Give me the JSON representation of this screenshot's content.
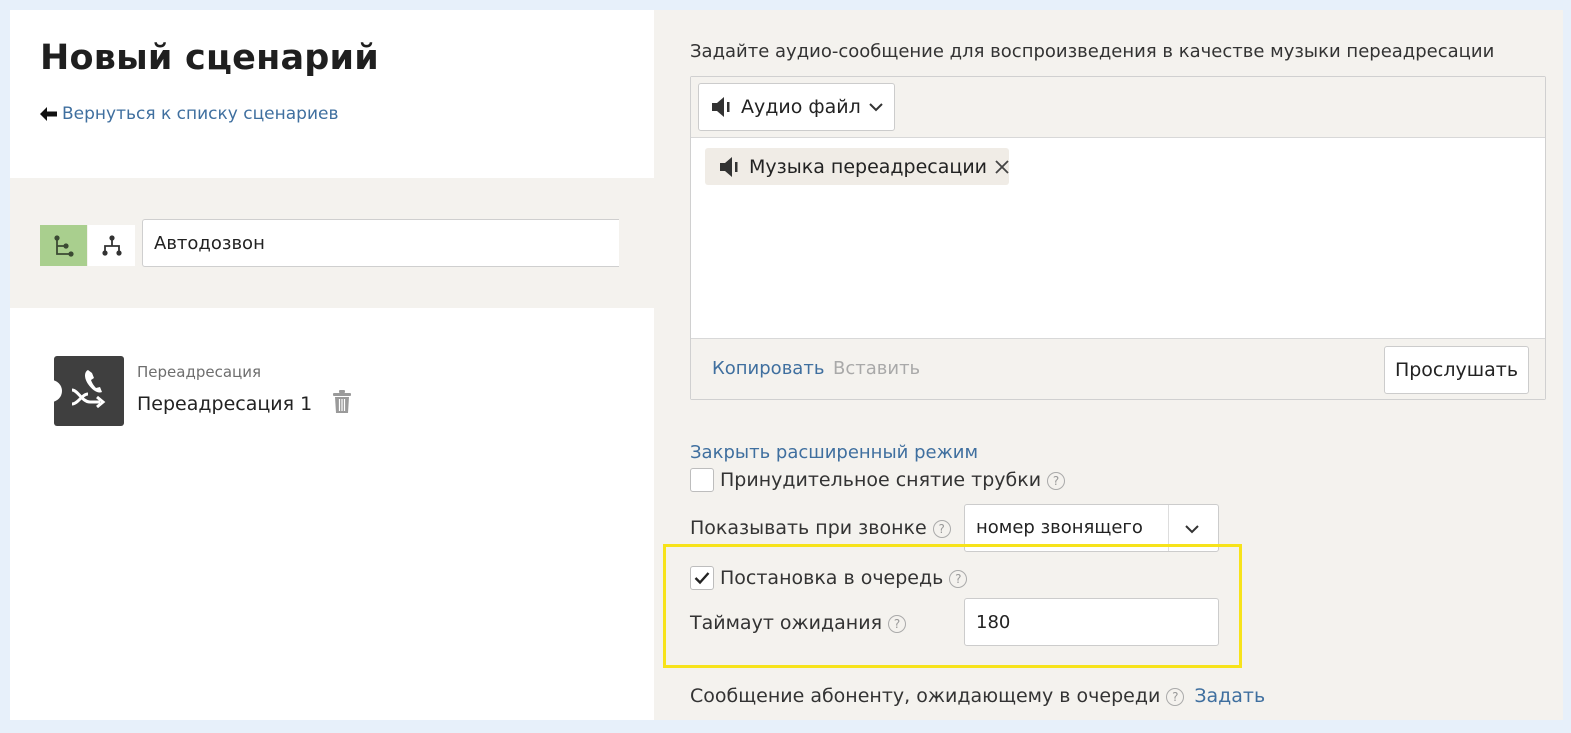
{
  "page": {
    "title": "Новый сценарий",
    "back_link": "Вернуться к списку сценариев"
  },
  "toolbar": {
    "scenario_name": "Автодозвон"
  },
  "node": {
    "type": "Переадресация",
    "name": "Переадресация 1"
  },
  "audio": {
    "heading": "Задайте аудио-сообщение для воспроизведения в качестве музыки переадресации",
    "source_dropdown": "Аудио файл",
    "selected_file": "Музыка переадресации",
    "copy": "Копировать",
    "paste": "Вставить",
    "listen": "Прослушать"
  },
  "advanced": {
    "close_link": "Закрыть расширенный режим",
    "force_pickup_label": "Принудительное снятие трубки",
    "force_pickup_checked": false,
    "show_on_call_label": "Показывать при звонке",
    "show_on_call_value": "номер звонящего",
    "queue_label": "Постановка в очередь",
    "queue_checked": true,
    "timeout_label": "Таймаут ожидания",
    "timeout_value": "180",
    "queue_message_label": "Сообщение абоненту, ожидающему в очереди",
    "queue_message_action": "Задать",
    "help_glyph": "?"
  },
  "colors": {
    "link": "#3f6f9f",
    "active_view": "#a9cf8e",
    "highlight": "#f7e31a",
    "panel_bg": "#f4f2ee"
  }
}
